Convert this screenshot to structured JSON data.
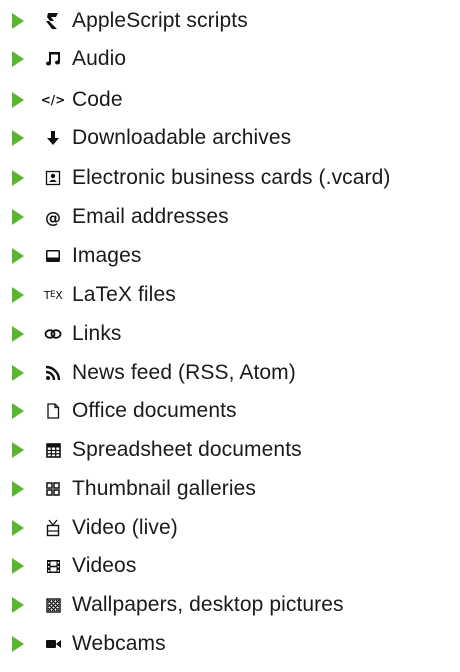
{
  "accent_color": "#5cb531",
  "items": [
    {
      "label": "AppleScript scripts",
      "icon": "applescript-icon"
    },
    {
      "label": "Audio",
      "icon": "music-note-icon"
    },
    {
      "label": "Code",
      "icon": "code-icon"
    },
    {
      "label": "Downloadable archives",
      "icon": "download-arrow-icon"
    },
    {
      "label": "Electronic business cards (.vcard)",
      "icon": "contact-card-icon"
    },
    {
      "label": "Email addresses",
      "icon": "at-sign-icon"
    },
    {
      "label": "Images",
      "icon": "image-icon"
    },
    {
      "label": "LaTeX files",
      "icon": "tex-icon"
    },
    {
      "label": "Links",
      "icon": "link-icon"
    },
    {
      "label": "News feed (RSS, Atom)",
      "icon": "rss-icon"
    },
    {
      "label": "Office documents",
      "icon": "document-icon"
    },
    {
      "label": "Spreadsheet documents",
      "icon": "spreadsheet-icon"
    },
    {
      "label": "Thumbnail galleries",
      "icon": "grid-icon"
    },
    {
      "label": "Video (live)",
      "icon": "tv-icon"
    },
    {
      "label": "Videos",
      "icon": "film-icon"
    },
    {
      "label": "Wallpapers, desktop pictures",
      "icon": "wallpaper-icon"
    },
    {
      "label": "Webcams",
      "icon": "video-camera-icon"
    }
  ]
}
